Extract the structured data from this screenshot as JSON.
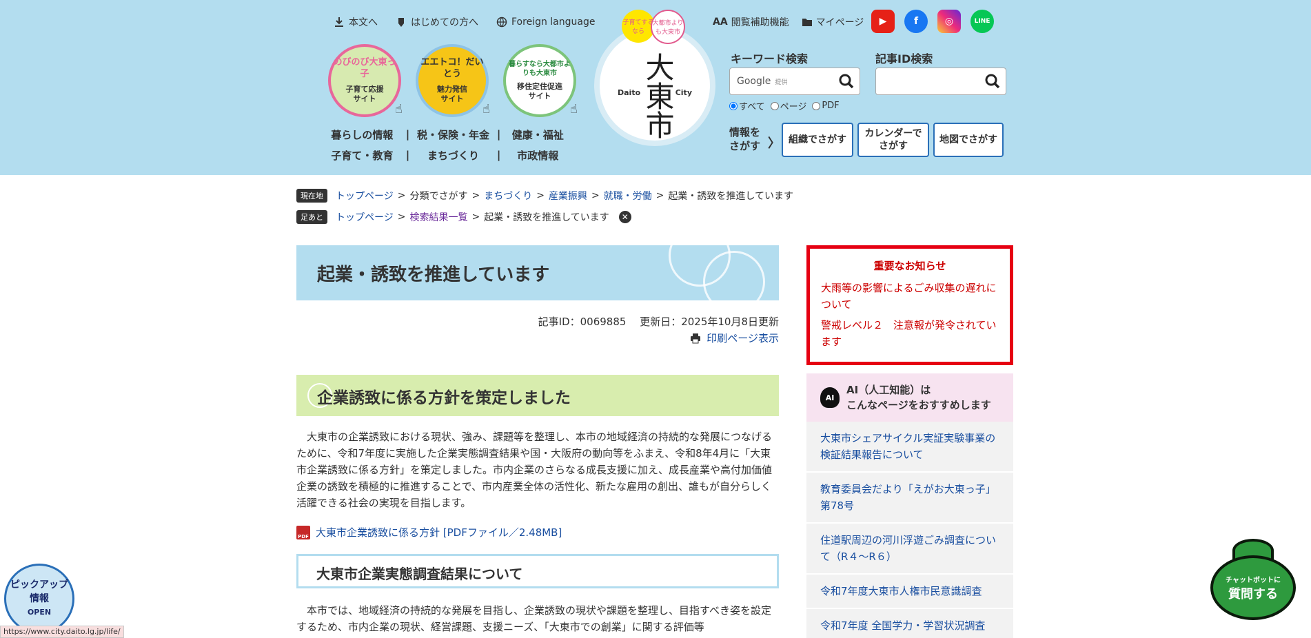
{
  "header": {
    "top_links": [
      {
        "icon": "download-icon",
        "label": "本文へ"
      },
      {
        "icon": "leaf-icon",
        "label": "はじめての方へ"
      },
      {
        "icon": "globe-icon",
        "label": "Foreign language"
      }
    ],
    "site_circles": [
      {
        "logo": "のびのび大東っ子",
        "label": "子育て応援\nサイト"
      },
      {
        "logo": "エエトコ！だいとう",
        "label": "魅力発信\nサイト"
      },
      {
        "logo": "暮らすなら大都市よりも大東市",
        "label": "移住定住促進\nサイト"
      }
    ],
    "nav_row1": [
      "暮らしの情報",
      "税・保険・年金",
      "健康・福祉"
    ],
    "nav_row2": [
      "子育て・教育",
      "まちづくり",
      "市政情報"
    ],
    "city_logo": {
      "kanji": "大東市",
      "left": "Daito",
      "right": "City"
    },
    "badge1": "子育てするなら",
    "badge2": "大都市よりも大東市",
    "util_links": [
      {
        "icon": "text-size-icon",
        "label": "閲覧補助機能"
      },
      {
        "icon": "folder-icon",
        "label": "マイページ"
      }
    ],
    "sns": [
      "YouTube",
      "Facebook",
      "Instagram",
      "LINE"
    ],
    "keyword_search": {
      "label": "キーワード検索",
      "google": "Google",
      "provided": "提供"
    },
    "id_search": {
      "label": "記事ID検索",
      "placeholder": ""
    },
    "radios": [
      "すべて",
      "ページ",
      "PDF"
    ],
    "find": {
      "label1": "情報を",
      "label2": "さがす",
      "arrow": "〉"
    },
    "find_buttons": [
      "組織でさがす",
      "カレンダーで\nさがす",
      "地図でさがす"
    ]
  },
  "breadcrumb": {
    "tag": "現在地",
    "items": [
      "トップページ",
      "分類でさがす",
      "まちづくり",
      "産業振興",
      "就職・労働",
      "起業・誘致を推進しています"
    ],
    "sep": ">"
  },
  "footprint": {
    "tag": "足あと",
    "items": [
      "トップページ",
      "検索結果一覧",
      "起業・誘致を推進しています"
    ],
    "close": "✕"
  },
  "article": {
    "title": "起業・誘致を推進しています",
    "meta": "記事ID：0069885　 更新日：2025年10月8日更新",
    "print": "印刷ページ表示",
    "h2": "企業誘致に係る方針を策定しました",
    "para1": "　大東市の企業誘致における現状、強み、課題等を整理し、本市の地域経済の持続的な発展につなげるために、令和7年度に実施した企業実態調査結果や国・大阪府の動向等をふまえ、令和8年4月に「大東市企業誘致に係る方針」を策定しました。市内企業のさらなる成長支援に加え、成長産業や高付加価値企業の誘致を積極的に推進することで、市内産業全体の活性化、新たな雇用の創出、誰もが自分らしく活躍できる社会の実現を目指します。",
    "pdf_link": "大東市企業誘致に係る方針 [PDFファイル／2.48MB]",
    "pdf_icon": "PDF",
    "h3": "大東市企業実態調査結果について",
    "para2": "　本市では、地域経済の持続的な発展を目指し、企業誘致の現状や課題を整理し、目指すべき姿を設定するため、市内企業の現状、経営課題、支援ニーズ、「大東市での創業」に関する評価等"
  },
  "sidebar": {
    "notice_title": "重要なお知らせ",
    "notices": [
      "大雨等の影響によるごみ収集の遅れについて",
      "警戒レベル２　注意報が発令されています"
    ],
    "ai_icon": "AI",
    "ai_title1": "AI（人工知能）は",
    "ai_title2": "こんなページをおすすめします",
    "recommendations": [
      "大東市シェアサイクル実証実験事業の検証結果報告について",
      "教育委員会だより「えがお大東っ子」第78号",
      "住道駅周辺の河川浮遊ごみ調査について（R４～R６）",
      "令和7年度大東市人権市民意識調査",
      "令和7年度 全国学力・学習状況調査"
    ]
  },
  "floating": {
    "pickup1": "ピックアップ",
    "pickup2": "情報",
    "pickup3": "OPEN",
    "chatbot1": "チャットボットに",
    "chatbot2": "質問する"
  },
  "status_url": "https://www.city.daito.lg.jp/life/"
}
